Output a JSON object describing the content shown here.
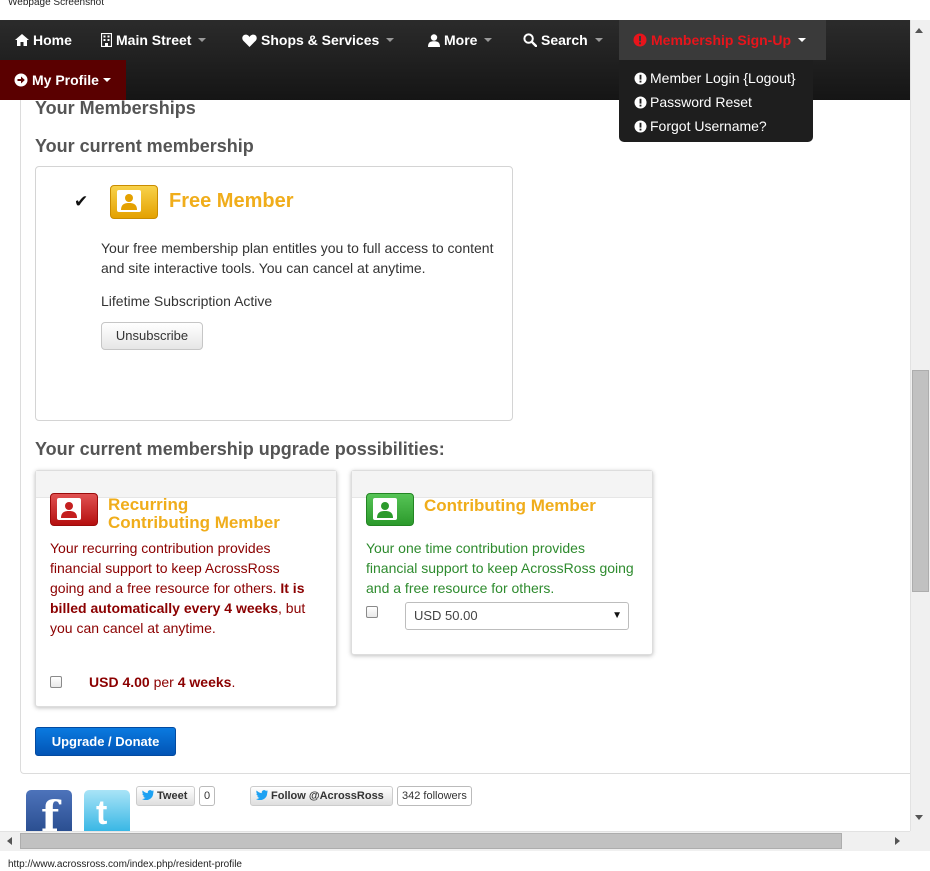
{
  "screenshot_label": "Webpage Screenshot",
  "status_url": "http://www.acrossross.com/index.php/resident-profile",
  "nav": {
    "home": "Home",
    "main_street": "Main Street",
    "shops_services": "Shops & Services",
    "more": "More",
    "search": "Search",
    "membership_signup": "Membership Sign-Up",
    "my_profile": "My Profile"
  },
  "dropdown": {
    "items": [
      {
        "label": "Member Login {Logout}"
      },
      {
        "label": "Password Reset"
      },
      {
        "label": "Forgot Username?"
      }
    ]
  },
  "content": {
    "heading_memberships": "Your Memberships",
    "heading_current": "Your current membership",
    "heading_upgrade": "Your current membership upgrade possibilities:"
  },
  "current_plan": {
    "check": "✔",
    "title": "Free Member",
    "description": "Your free membership plan entitles you to full access to content and site interactive tools. You can cancel at anytime.",
    "status": "Lifetime Subscription Active",
    "unsubscribe_label": "Unsubscribe"
  },
  "recurring_plan": {
    "title_line1": "Recurring",
    "title_line2": "Contributing Member",
    "desc_intro": "Your recurring contribution provides financial support to keep AcrossRoss going and a free resource for others.",
    "desc_bold": "It is billed automatically every 4 weeks",
    "desc_tail": ", but you can cancel at anytime.",
    "price_amount": "USD 4.00",
    "price_per": "per",
    "price_period": "4 weeks",
    "price_end": "."
  },
  "contributing_plan": {
    "title": "Contributing Member",
    "description": "Your one time contribution provides financial support to keep AcrossRoss going and a free resource for others.",
    "selected_amount": "USD 50.00"
  },
  "upgrade_button": "Upgrade / Donate",
  "social": {
    "fb_glyph": "f",
    "tw_glyph": "t",
    "tweet_label": "Tweet",
    "tweet_count": "0",
    "follow_label": "Follow @AcrossRoss",
    "followers": "342 followers"
  },
  "colors": {
    "accent_orange": "#f0ad1b",
    "recurring_text": "#8b0000",
    "contributing_text": "#2e8b2e",
    "membership_nav": "#e8141b",
    "primary_button": "#0254b5"
  }
}
